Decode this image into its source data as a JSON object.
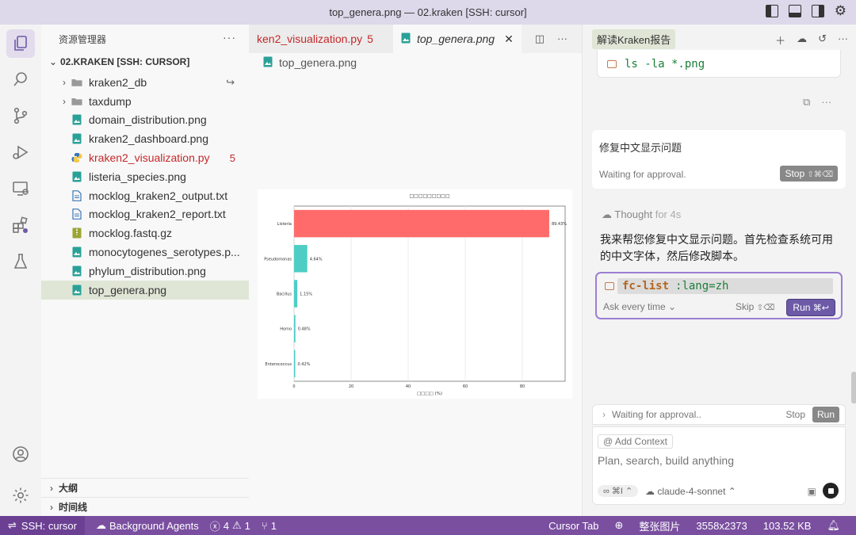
{
  "window": {
    "title": "top_genera.png — 02.kraken [SSH: cursor]"
  },
  "explorer": {
    "header": "资源管理器",
    "root": "02.KRAKEN [SSH: CURSOR]",
    "items": [
      {
        "label": "kraken2_db",
        "type": "folder"
      },
      {
        "label": "taxdump",
        "type": "folder"
      },
      {
        "label": "domain_distribution.png",
        "type": "image"
      },
      {
        "label": "kraken2_dashboard.png",
        "type": "image"
      },
      {
        "label": "kraken2_visualization.py",
        "type": "python",
        "badge": "5"
      },
      {
        "label": "listeria_species.png",
        "type": "image"
      },
      {
        "label": "mocklog_kraken2_output.txt",
        "type": "text"
      },
      {
        "label": "mocklog_kraken2_report.txt",
        "type": "text"
      },
      {
        "label": "mocklog.fastq.gz",
        "type": "archive"
      },
      {
        "label": "monocytogenes_serotypes.p...",
        "type": "image"
      },
      {
        "label": "phylum_distribution.png",
        "type": "image"
      },
      {
        "label": "top_genera.png",
        "type": "image"
      }
    ],
    "outline": "大纲",
    "timeline": "时间线"
  },
  "editor": {
    "tab_inactive": "ken2_visualization.py",
    "tab_inactive_badge": "5",
    "tab_active": "top_genera.png",
    "breadcrumb": "top_genera.png"
  },
  "chart_data": {
    "type": "bar",
    "title": "",
    "categories": [
      "Listeria",
      "Pseudomonas",
      "Bacillus",
      "Homo",
      "Enterococcus"
    ],
    "values": [
      89.43,
      4.64,
      1.15,
      0.48,
      0.42
    ],
    "value_labels": [
      "89.43%",
      "4.64%",
      "1.15%",
      "0.48%",
      "0.42%"
    ],
    "colors": [
      "#ff6b6b",
      "#4ecdc4",
      "#4ecdc4",
      "#4ecdc4",
      "#4ecdc4"
    ],
    "xlabel": "□□□□ (%)",
    "xticks": [
      "0",
      "20",
      "40",
      "60",
      "80"
    ],
    "xlim": [
      0,
      95
    ],
    "grid": true
  },
  "chat": {
    "tab": "解读Kraken报告",
    "cmd1": "ls -la *.png",
    "card1_title": "修复中文显示问题",
    "card1_status": "Waiting for approval.",
    "stop_label": "Stop",
    "stop_shortcut": "⇧⌘⌫",
    "thought_label": "Thought",
    "thought_time": "for 4s",
    "message": "我来帮您修复中文显示问题。首先检查系统可用的中文字体，然后修改脚本。",
    "cmd2_name": "fc-list",
    "cmd2_arg": ":lang=zh",
    "ask_every_time": "Ask every time",
    "skip_label": "Skip",
    "skip_shortcut": "⇧⌫",
    "run_label": "Run",
    "run_shortcut": "⌘↩",
    "bottom_status": "Waiting for approval..",
    "bottom_stop": "Stop",
    "bottom_run": "Run",
    "add_context": "Add Context",
    "input_placeholder": "Plan, search, build anything",
    "mode_shortcut": "⌘I",
    "model": "claude-4-sonnet"
  },
  "statusbar": {
    "remote": "SSH: cursor",
    "agents": "Background Agents",
    "errors": "4",
    "warnings": "1",
    "ports": "1",
    "cursor_tab": "Cursor Tab",
    "image_mode": "整张图片",
    "dimensions": "3558x2373",
    "filesize": "103.52 KB"
  }
}
